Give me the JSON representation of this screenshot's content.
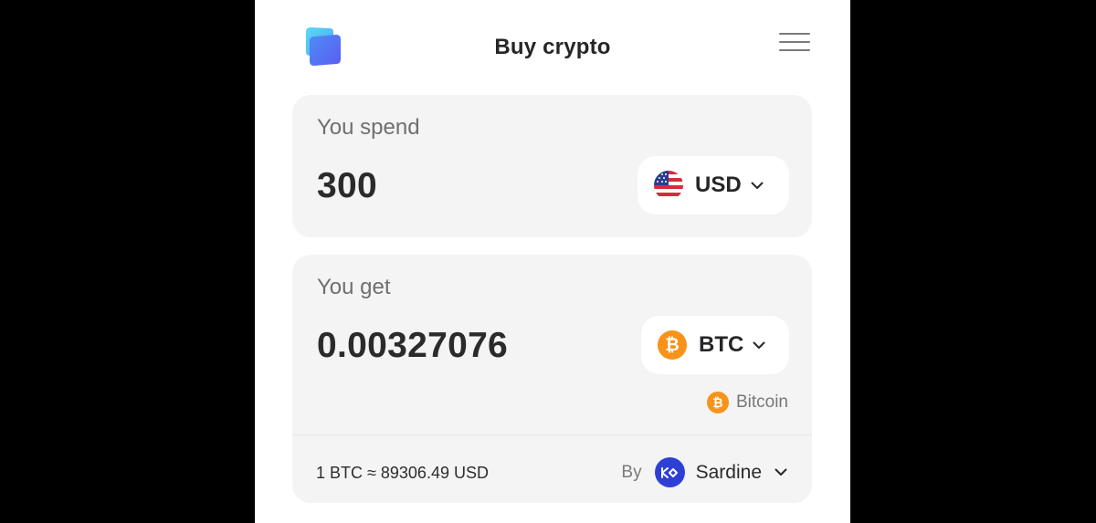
{
  "header": {
    "title": "Buy crypto",
    "logo_icon": "app-logo-icon",
    "menu_icon": "hamburger-menu-icon"
  },
  "spend": {
    "label": "You spend",
    "amount": "300",
    "currency": {
      "code": "USD",
      "icon": "us-flag-icon"
    }
  },
  "get": {
    "label": "You get",
    "amount": "0.00327076",
    "currency": {
      "code": "BTC",
      "icon": "bitcoin-icon"
    },
    "network": {
      "name": "Bitcoin",
      "icon": "bitcoin-icon"
    }
  },
  "quote": {
    "rate": "1 BTC ≈ 89306.49 USD",
    "by_label": "By",
    "provider": {
      "name": "Sardine",
      "icon": "sardine-logo-icon"
    }
  },
  "colors": {
    "background": "#000000",
    "panel": "#ffffff",
    "card": "#f4f4f5",
    "bitcoin": "#f7931a",
    "provider": "#2e3fd6",
    "logo_light": "#5ad8f5",
    "logo_dark": "#4f6ef7"
  }
}
